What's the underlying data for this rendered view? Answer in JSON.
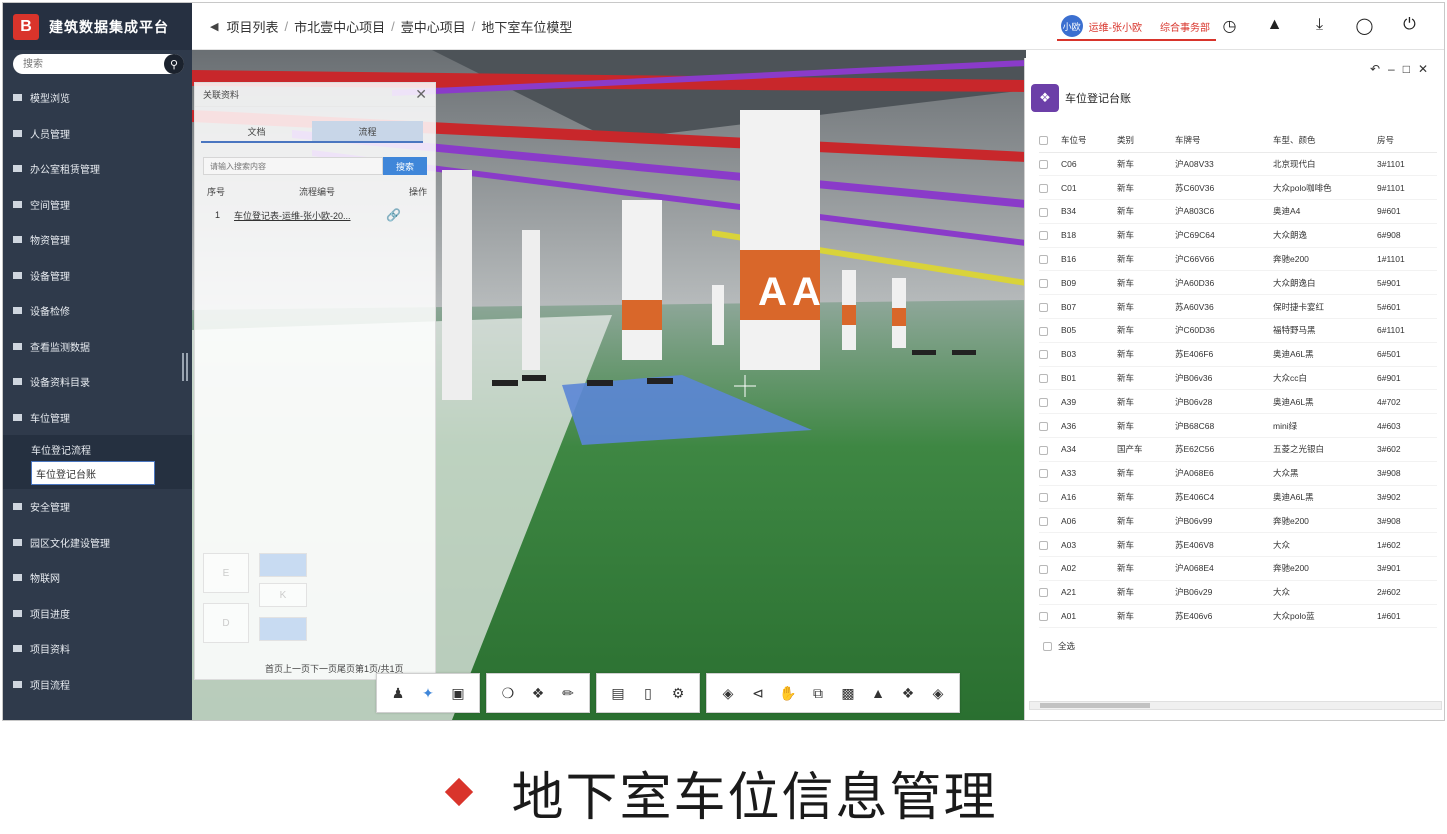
{
  "app": {
    "logo_letter": "B",
    "name": "建筑数据集成平台"
  },
  "search": {
    "placeholder": "搜索"
  },
  "sidebar": {
    "items": [
      {
        "label": "模型浏览"
      },
      {
        "label": "人员管理"
      },
      {
        "label": "办公室租赁管理"
      },
      {
        "label": "空间管理"
      },
      {
        "label": "物资管理"
      },
      {
        "label": "设备管理"
      },
      {
        "label": "设备检修"
      },
      {
        "label": "查看监测数据"
      },
      {
        "label": "设备资料目录"
      },
      {
        "label": "车位管理"
      }
    ],
    "sub_items": [
      {
        "label": "车位登记流程"
      },
      {
        "label": "车位登记台账"
      }
    ],
    "items_after": [
      {
        "label": "安全管理"
      },
      {
        "label": "园区文化建设管理"
      },
      {
        "label": "物联网"
      },
      {
        "label": "项目进度"
      },
      {
        "label": "项目资料"
      },
      {
        "label": "项目流程"
      }
    ]
  },
  "breadcrumb": {
    "back_icon": "chevron-left",
    "items": [
      "项目列表",
      "市北壹中心项目",
      "壹中心项目",
      "地下室车位模型"
    ],
    "separator": "/"
  },
  "user": {
    "avatar_text": "小欧",
    "name": "运维-张小欧",
    "dept": "综合事务部",
    "accent": "#d8342b"
  },
  "header_icons": [
    "clock-icon",
    "bell-icon",
    "download-icon",
    "bulb-icon",
    "power-icon"
  ],
  "assoc_panel": {
    "title": "关联资料",
    "tabs": [
      "文档",
      "流程"
    ],
    "active_tab": 1,
    "search_placeholder": "请输入搜索内容",
    "search_button": "搜索",
    "columns": [
      "序号",
      "流程编号",
      "操作"
    ],
    "rows": [
      {
        "no": "1",
        "name": "车位登记表-运维-张小欧-20..."
      }
    ],
    "pager": "首页上一页下一页尾页第1页/共1页"
  },
  "ledger": {
    "title": "车位登记台账",
    "columns": [
      "车位号",
      "类别",
      "车牌号",
      "车型、颜色",
      "房号"
    ],
    "rows": [
      {
        "slot": "C06",
        "type": "新车",
        "plate": "沪A08V33",
        "model": "北京现代白",
        "room": "3#1101"
      },
      {
        "slot": "C01",
        "type": "新车",
        "plate": "苏C60V36",
        "model": "大众polo咖啡色",
        "room": "9#1101"
      },
      {
        "slot": "B34",
        "type": "新车",
        "plate": "沪A803C6",
        "model": "奥迪A4",
        "room": "9#601"
      },
      {
        "slot": "B18",
        "type": "新车",
        "plate": "沪C69C64",
        "model": "大众朗逸",
        "room": "6#908"
      },
      {
        "slot": "B16",
        "type": "新车",
        "plate": "沪C66V66",
        "model": "奔驰e200",
        "room": "1#1101"
      },
      {
        "slot": "B09",
        "type": "新车",
        "plate": "沪A60D36",
        "model": "大众朗逸白",
        "room": "5#901"
      },
      {
        "slot": "B07",
        "type": "新车",
        "plate": "苏A60V36",
        "model": "保时捷卡宴红",
        "room": "5#601"
      },
      {
        "slot": "B05",
        "type": "新车",
        "plate": "沪C60D36",
        "model": "福特野马黑",
        "room": "6#1101"
      },
      {
        "slot": "B03",
        "type": "新车",
        "plate": "苏E406F6",
        "model": "奥迪A6L黑",
        "room": "6#501"
      },
      {
        "slot": "B01",
        "type": "新车",
        "plate": "沪B06v36",
        "model": "大众cc白",
        "room": "6#901"
      },
      {
        "slot": "A39",
        "type": "新车",
        "plate": "沪B06v28",
        "model": "奥迪A6L黑",
        "room": "4#702"
      },
      {
        "slot": "A36",
        "type": "新车",
        "plate": "沪B68C68",
        "model": "mini绿",
        "room": "4#603"
      },
      {
        "slot": "A34",
        "type": "国产车",
        "plate": "苏E62C56",
        "model": "五菱之光银白",
        "room": "3#602"
      },
      {
        "slot": "A33",
        "type": "新车",
        "plate": "沪A068E6",
        "model": "大众黑",
        "room": "3#908"
      },
      {
        "slot": "A16",
        "type": "新车",
        "plate": "苏E406C4",
        "model": "奥迪A6L黑",
        "room": "3#902"
      },
      {
        "slot": "A06",
        "type": "新车",
        "plate": "沪B06v99",
        "model": "奔驰e200",
        "room": "3#908"
      },
      {
        "slot": "A03",
        "type": "新车",
        "plate": "苏E406V8",
        "model": "大众",
        "room": "1#602"
      },
      {
        "slot": "A02",
        "type": "新车",
        "plate": "沪A068E4",
        "model": "奔驰e200",
        "room": "3#901"
      },
      {
        "slot": "A21",
        "type": "新车",
        "plate": "沪B06v29",
        "model": "大众",
        "room": "2#602"
      },
      {
        "slot": "A01",
        "type": "新车",
        "plate": "苏E406v6",
        "model": "大众polo蓝",
        "room": "1#601"
      }
    ],
    "select_all": "全选",
    "window_controls": [
      "restore-icon",
      "minimize-icon",
      "maximize-icon",
      "close-icon"
    ]
  },
  "scene": {
    "pillar_letter": "A",
    "floor_color": "#2f7a36",
    "pipe_red": "#c8272b",
    "pipe_purple": "#8a3bc9",
    "pillar_orange": "#d9672a",
    "highlight_blue": "#5b86d6"
  },
  "toolbar_groups": [
    [
      "person-locate-icon",
      "walk-icon",
      "camera-icon"
    ],
    [
      "cube-rotate-icon",
      "explode-icon",
      "measure-icon"
    ],
    [
      "doc-icon",
      "device-icon",
      "settings-icon"
    ],
    [
      "layers-icon",
      "share-icon",
      "hand-icon",
      "copy-icon",
      "box-icon",
      "tree-icon",
      "section-icon",
      "paint-icon"
    ]
  ],
  "ghost_controls": {
    "label_e": "E",
    "label_d": "D",
    "label_k": "K"
  },
  "caption": "地下室车位信息管理"
}
